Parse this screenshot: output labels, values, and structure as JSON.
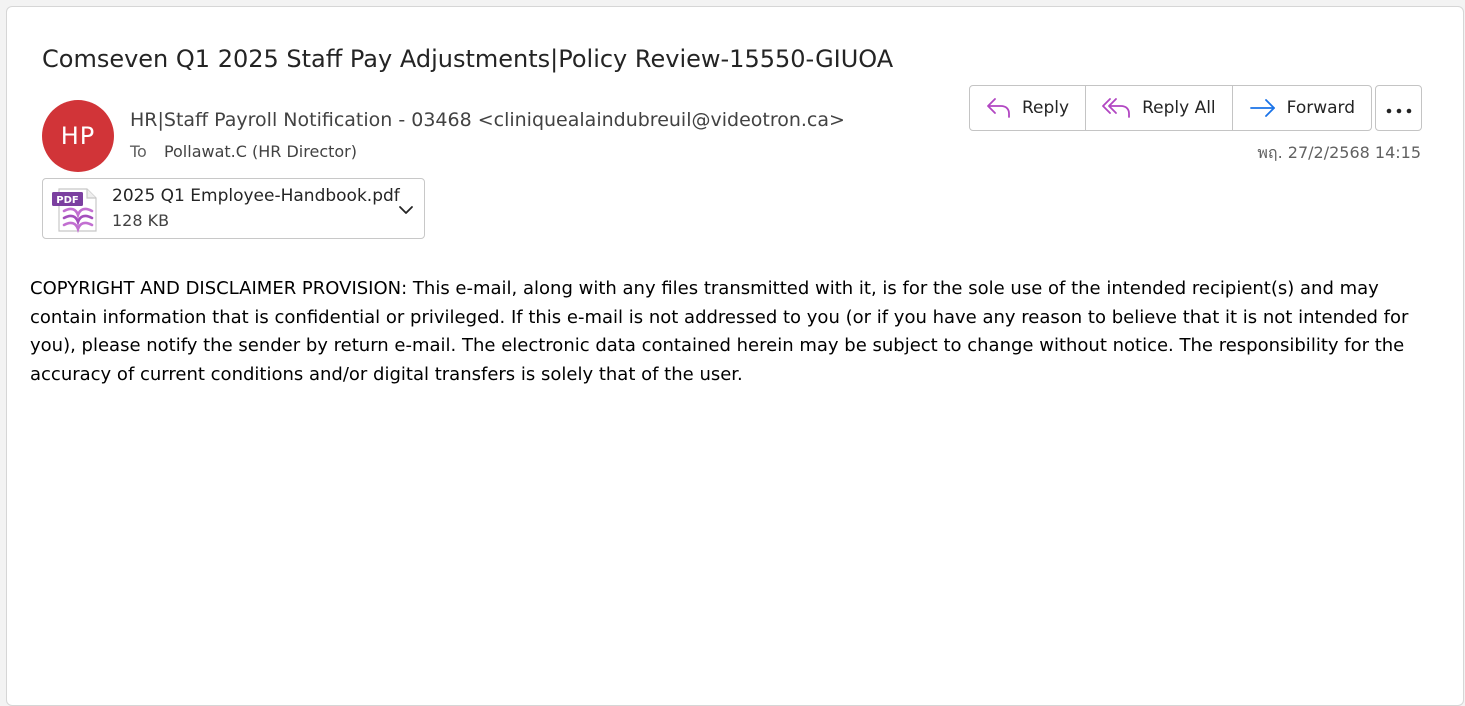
{
  "email": {
    "subject": "Comseven Q1 2025 Staff Pay Adjustments|Policy Review-15550-GIUOA",
    "avatar_initials": "HP",
    "avatar_color": "#d13438",
    "sender": "HR|Staff Payroll Notification - 03468 <cliniquealaindubreuil@videotron.ca>",
    "to_label": "To",
    "to_value": "Pollawat.C (HR Director)",
    "date": "พฤ. 27/2/2568 14:15"
  },
  "actions": {
    "reply_label": "Reply",
    "reply_all_label": "Reply All",
    "forward_label": "Forward",
    "more_icon": "more-horizontal-icon"
  },
  "attachment": {
    "icon": "pdf-file-icon",
    "name": "2025 Q1 Employee-Handbook.pdf",
    "size": "128 KB"
  },
  "body": {
    "text": "COPYRIGHT AND DISCLAIMER PROVISION: This e-mail, along with any files transmitted with it, is for the sole use of the intended recipient(s) and may contain information that is confidential or privileged. If this e-mail is not addressed to you (or if you have any reason to believe that it is not intended for you), please notify the sender by return e-mail. The electronic data contained herein may be subject to change without notice. The responsibility for the accuracy of current conditions and/or digital transfers is solely that of the user."
  },
  "colors": {
    "reply_icon": "#b146c2",
    "forward_icon": "#1a73e8"
  }
}
